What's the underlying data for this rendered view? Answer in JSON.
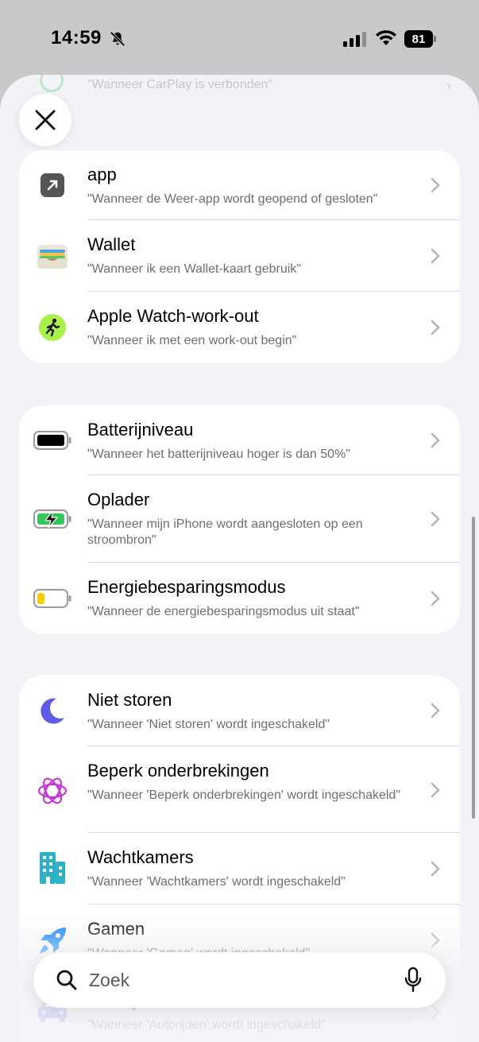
{
  "status": {
    "time": "14:59",
    "battery": "81"
  },
  "ghost_row": {
    "subtitle": "\"Wanneer CarPlay is verbonden\""
  },
  "groups": [
    {
      "items": [
        {
          "title": "app",
          "subtitle": "\"Wanneer de Weer-app wordt geopend of gesloten\"",
          "icon": "app-arrow-icon"
        },
        {
          "title": "Wallet",
          "subtitle": "\"Wanneer ik een Wallet-kaart gebruik\"",
          "icon": "wallet-icon"
        },
        {
          "title": "Apple Watch-work-out",
          "subtitle": "\"Wanneer ik met een work-out begin\"",
          "icon": "workout-icon"
        }
      ]
    },
    {
      "items": [
        {
          "title": "Batterijniveau",
          "subtitle": "\"Wanneer het batterijniveau hoger is dan 50%\"",
          "icon": "battery-level-icon"
        },
        {
          "title": "Oplader",
          "subtitle": "\"Wanneer mijn iPhone wordt aangesloten op een stroombron\"",
          "icon": "charger-icon"
        },
        {
          "title": "Energiebesparingsmodus",
          "subtitle": "\"Wanneer de energiebesparingsmodus uit staat\"",
          "icon": "low-power-icon"
        }
      ]
    },
    {
      "items": [
        {
          "title": "Niet storen",
          "subtitle": "\"Wanneer 'Niet storen' wordt ingeschakeld\"",
          "icon": "moon-icon"
        },
        {
          "title": "Beperk onderbrekingen",
          "subtitle": "\"Wanneer 'Beperk onderbrekingen' wordt ingeschakeld\"",
          "icon": "reduce-interruptions-icon"
        },
        {
          "title": "Wachtkamers",
          "subtitle": "\"Wanneer 'Wachtkamers' wordt ingeschakeld\"",
          "icon": "building-icon"
        },
        {
          "title": "Gamen",
          "subtitle": "\"Wanneer 'Gamen' wordt ingeschakeld\"",
          "icon": "rocket-icon"
        },
        {
          "title": "Autorijden",
          "subtitle": "\"Wanneer 'Autorijden' wordt ingeschakeld\"",
          "icon": "car-icon"
        }
      ]
    }
  ],
  "search": {
    "placeholder": "Zoek"
  },
  "colors": {
    "accent_green": "#33c759",
    "workout_lime": "#a8f04a",
    "moon_purple": "#5e5ce6",
    "focus_magenta": "#c237d6",
    "building_teal": "#30b0c7",
    "rocket_blue": "#0a84ff"
  }
}
